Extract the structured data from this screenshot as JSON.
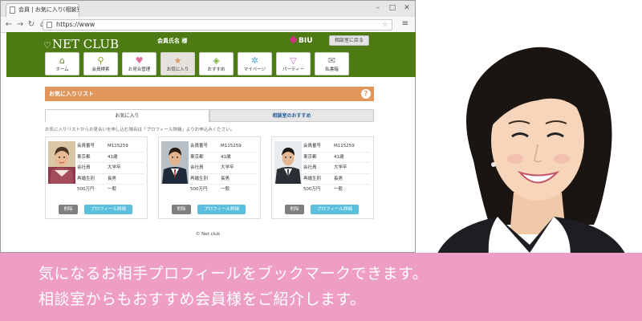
{
  "browser": {
    "tab_title": "会員 | お気に入り(相談室の...",
    "url": "https://www",
    "controls": [
      "–",
      "□",
      "✕"
    ]
  },
  "header": {
    "logo": "NET CLUB",
    "member_name": "会員氏名 様",
    "biu": "BIU",
    "return_button": "相談室に戻る",
    "nav": [
      {
        "label": "ホーム",
        "icon": "home-icon"
      },
      {
        "label": "会員検索",
        "icon": "search-icon"
      },
      {
        "label": "お見合管理",
        "icon": "heart-icon"
      },
      {
        "label": "お気に入り",
        "icon": "star-icon"
      },
      {
        "label": "おすすめ",
        "icon": "tag-icon"
      },
      {
        "label": "マイページ",
        "icon": "gear-icon"
      },
      {
        "label": "パーティー",
        "icon": "cocktail-icon"
      },
      {
        "label": "私書箱",
        "icon": "envelope-icon"
      }
    ]
  },
  "favorites": {
    "title": "お気に入りリスト",
    "tabs": [
      "お気に入り",
      "相談室のおすすめ"
    ],
    "notice": "お気に入りリストからお見合いを申し込む場合は「プロフィール詳細」よりお申込みください。",
    "labels": {
      "member_no": "会員番号",
      "job": "会社員",
      "marital": "再婚生別"
    },
    "cards": [
      {
        "member_no": "M115259",
        "pref": "東京都",
        "age": "41歳",
        "job": "会社員",
        "edu": "大学卒",
        "marital": "再婚生別",
        "sibling": "長男",
        "income": "500万円",
        "type": "一般"
      },
      {
        "member_no": "M115259",
        "pref": "東京都",
        "age": "41歳",
        "job": "会社員",
        "edu": "大学卒",
        "marital": "再婚生別",
        "sibling": "長男",
        "income": "500万円",
        "type": "一般"
      },
      {
        "member_no": "M115259",
        "pref": "東京都",
        "age": "41歳",
        "job": "会社員",
        "edu": "大学卒",
        "marital": "再婚生別",
        "sibling": "長男",
        "income": "500万円",
        "type": "一般"
      }
    ],
    "delete_label": "削除",
    "detail_label": "プロフィール詳細",
    "footer": "© Net club"
  },
  "caption": {
    "line1": "気になるお相手プロフィールをブックマークできます。",
    "line2": "相談室からもおすすめ会員様をご紹介します。"
  },
  "colors": {
    "header_green": "#4d7a12",
    "fav_orange": "#e0955a",
    "band_pink": "#ee9dc5",
    "detail_blue": "#5bc0de"
  }
}
